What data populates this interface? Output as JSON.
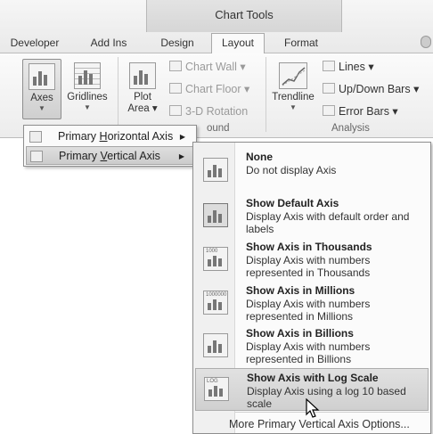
{
  "ribbon": {
    "contextual_header": "Chart Tools",
    "tabs": [
      "Developer",
      "Add Ins",
      "Design",
      "Layout",
      "Format"
    ],
    "active_tab": "Layout",
    "buttons": {
      "axes": "Axes",
      "gridlines": "Gridlines",
      "plot_area_line1": "Plot",
      "plot_area_line2": "Area",
      "chart_wall": "Chart Wall",
      "chart_floor": "Chart Floor",
      "rotation_3d": "3-D Rotation",
      "trendline": "Trendline",
      "lines": "Lines",
      "updown_bars": "Up/Down Bars",
      "error_bars": "Error Bars"
    },
    "group_labels": {
      "background": "ound",
      "analysis": "Analysis"
    }
  },
  "axes_menu": {
    "items": [
      {
        "label": "Primary Horizontal Axis",
        "hotkey": "H"
      },
      {
        "label": "Primary Vertical Axis",
        "hotkey": "V"
      }
    ]
  },
  "vertical_axis_submenu": {
    "options": [
      {
        "title": "None",
        "desc": "Do not display Axis",
        "icon": "no-axis-icon"
      },
      {
        "title": "Show Default Axis",
        "desc": "Display Axis with default order and labels",
        "icon": "default-axis-icon"
      },
      {
        "title": "Show Axis in Thousands",
        "desc": "Display Axis with numbers represented in Thousands",
        "icon": "thousands-axis-icon",
        "tag": "1000"
      },
      {
        "title": "Show Axis in Millions",
        "desc": "Display Axis with numbers represented in Millions",
        "icon": "millions-axis-icon",
        "tag": "1000000"
      },
      {
        "title": "Show Axis in Billions",
        "desc": "Display Axis with numbers represented in Billions",
        "icon": "billions-axis-icon"
      },
      {
        "title": "Show Axis with Log Scale",
        "desc": "Display Axis using a log 10 based scale",
        "icon": "log-scale-axis-icon",
        "tag": "LOG"
      }
    ],
    "more_options": "More Primary Vertical Axis Options..."
  }
}
